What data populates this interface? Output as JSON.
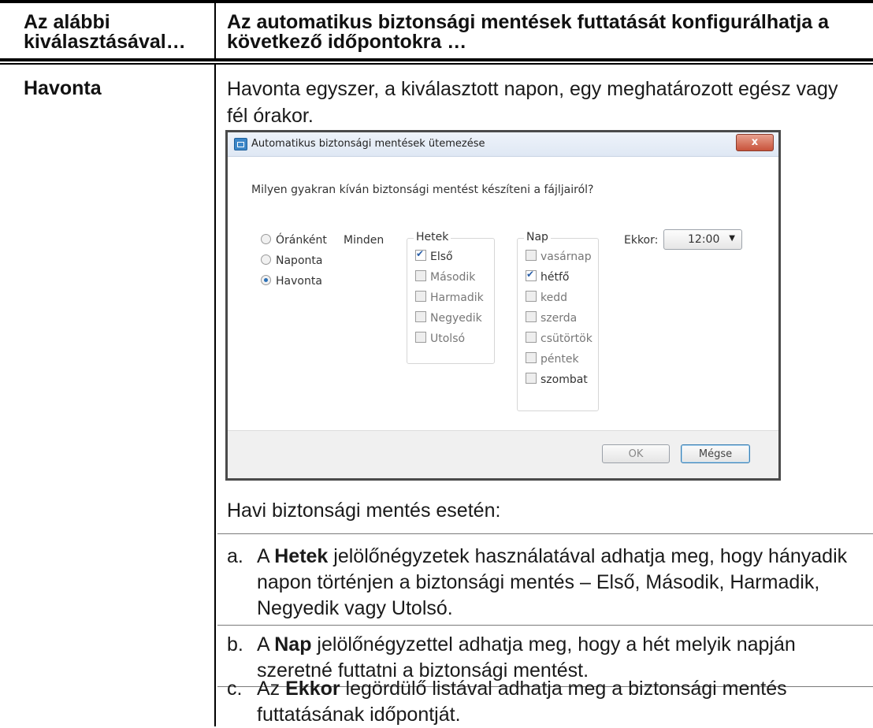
{
  "table": {
    "header_left": "Az alábbi kiválasztásával…",
    "header_right": "Az automatikus biztonsági mentések futtatását konfigurálhatja a következő időpontokra …",
    "row_label": "Havonta",
    "intro": "Havonta egyszer, a kiválasztott napon, egy meghatározott egész vagy fél órakor."
  },
  "dialog": {
    "title": "Automatikus biztonsági mentések ütemezése",
    "close_label": "x",
    "question": "Milyen gyakran kíván biztonsági mentést készíteni a fájljairól?",
    "frequency_options": [
      {
        "label": "Óránként",
        "selected": false
      },
      {
        "label": "Naponta",
        "selected": false
      },
      {
        "label": "Havonta",
        "selected": true
      }
    ],
    "minden_label": "Minden",
    "weeks_legend": "Hetek",
    "weeks": [
      {
        "label": "Első",
        "checked": true
      },
      {
        "label": "Második",
        "checked": false
      },
      {
        "label": "Harmadik",
        "checked": false
      },
      {
        "label": "Negyedik",
        "checked": false
      },
      {
        "label": "Utolsó",
        "checked": false
      }
    ],
    "days_legend": "Nap",
    "days": [
      {
        "label": "vasárnap",
        "checked": false
      },
      {
        "label": "hétfő",
        "checked": true
      },
      {
        "label": "kedd",
        "checked": false
      },
      {
        "label": "szerda",
        "checked": false
      },
      {
        "label": "csütörtök",
        "checked": false
      },
      {
        "label": "péntek",
        "checked": false
      },
      {
        "label": "szombat",
        "checked": false
      }
    ],
    "ekkor_label": "Ekkor:",
    "ekkor_value": "12:00",
    "ok_label": "OK",
    "cancel_label": "Mégse"
  },
  "instructions": {
    "lead": "Havi biztonsági mentés esetén:",
    "items": [
      {
        "marker": "a.",
        "prefix": "A ",
        "bold": "Hetek",
        "rest": " jelölőnégyzetek használatával adhatja meg, hogy hányadik napon történjen a biztonsági mentés – Első, Második, Harmadik, Negyedik vagy Utolsó."
      },
      {
        "marker": "b.",
        "prefix": "A ",
        "bold": "Nap",
        "rest": " jelölőnégyzettel adhatja meg, hogy a hét melyik napján szeretné futtatni a biztonsági mentést."
      },
      {
        "marker": "c.",
        "prefix": "Az ",
        "bold": "Ekkor",
        "rest": " legördülő listával adhatja meg a biztonsági mentés futtatásának időpontját."
      }
    ]
  }
}
